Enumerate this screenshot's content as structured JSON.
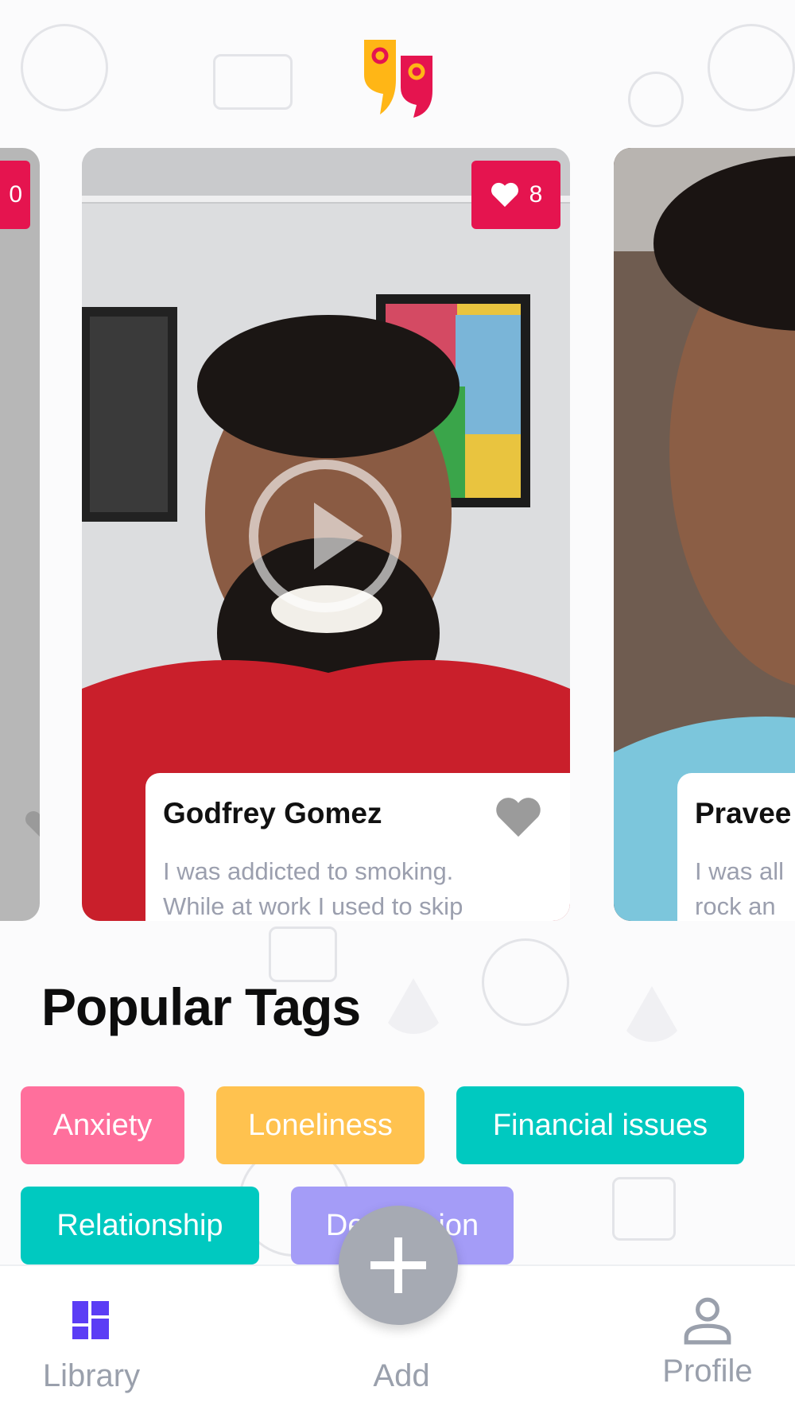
{
  "app": {
    "logo_icon": "quote-bubbles-logo",
    "accent": "#5b3df5",
    "like_color": "#e5144f"
  },
  "carousel": {
    "cards": [
      {
        "id": "left",
        "likes": "0"
      },
      {
        "id": "main",
        "likes": "8",
        "name": "Godfrey Gomez",
        "excerpt_line1": "I was addicted to smoking.",
        "excerpt_line2": "While at work I used to skip"
      },
      {
        "id": "right",
        "name": "Pravee",
        "excerpt_line1": "I was all",
        "excerpt_line2": "rock an"
      }
    ]
  },
  "popular_tags": {
    "title": "Popular Tags",
    "tags": [
      {
        "label": "Anxiety",
        "color": "#ff6f9c"
      },
      {
        "label": "Loneliness",
        "color": "#ffc24f"
      },
      {
        "label": "Financial issues",
        "color": "#00c9c0"
      },
      {
        "label": "Relationship",
        "color": "#00c9c0"
      },
      {
        "label": "Depression",
        "color": "#a49cf7"
      }
    ]
  },
  "bottom_nav": {
    "items": [
      {
        "label": "Library",
        "icon": "grid-icon",
        "active": true
      },
      {
        "label": "Add",
        "icon": "plus-icon"
      },
      {
        "label": "Profile",
        "icon": "person-icon"
      }
    ]
  }
}
